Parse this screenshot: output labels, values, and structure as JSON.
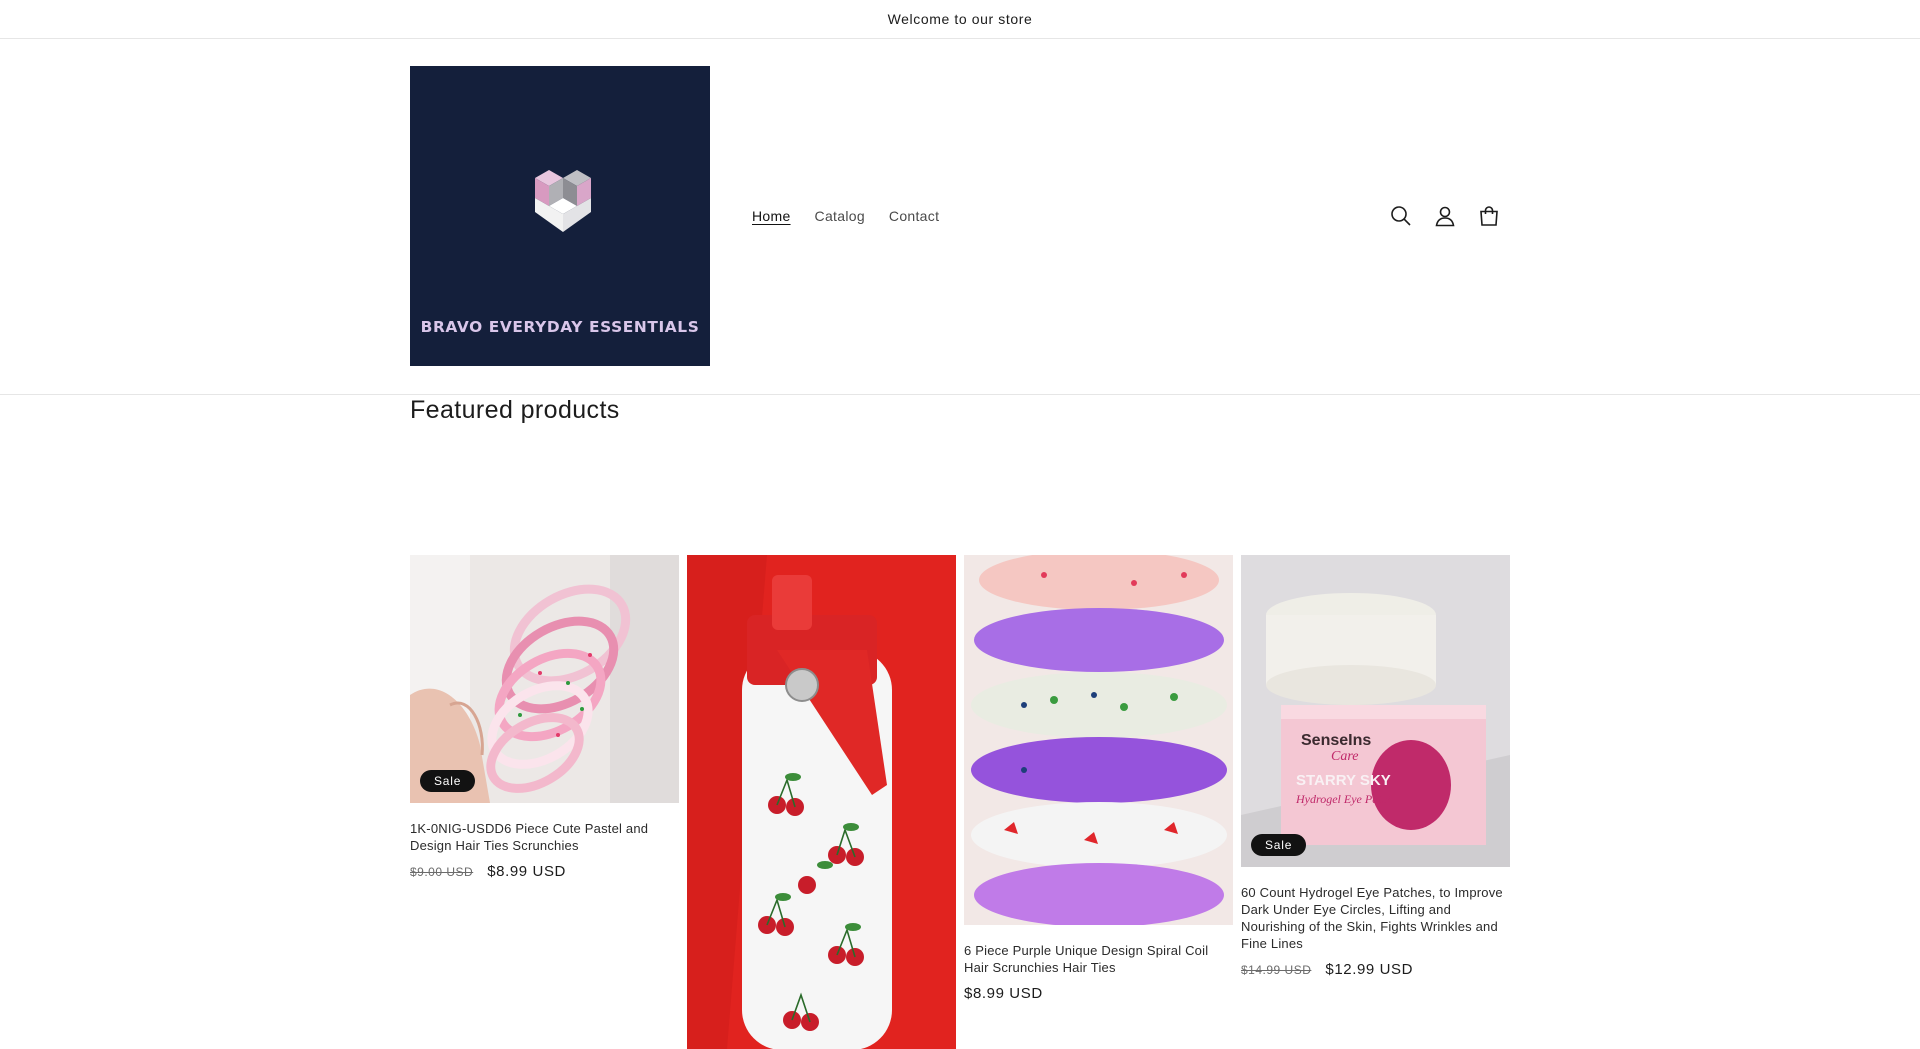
{
  "announcement": {
    "text": "Welcome to our store"
  },
  "brand": {
    "name": "BRAVO EVERYDAY ESSENTIALS",
    "bg": "#141f3b"
  },
  "nav": {
    "items": [
      {
        "label": "Home",
        "active": true
      },
      {
        "label": "Catalog",
        "active": false
      },
      {
        "label": "Contact",
        "active": false
      }
    ]
  },
  "header_icons": [
    "search-icon",
    "account-icon",
    "cart-icon"
  ],
  "featured": {
    "heading": "Featured products",
    "products": [
      {
        "title": "1K-0NIG-USDD6 Piece Cute Pastel and Design Hair Ties Scrunchies",
        "compare_price": "$9.00 USD",
        "price": "$8.99 USD",
        "badge": "Sale"
      },
      {
        "title": "",
        "compare_price": "",
        "price": "",
        "badge": ""
      },
      {
        "title": "6 Piece Purple Unique Design Spiral Coil Hair Scrunchies Hair Ties",
        "compare_price": "",
        "price": "$8.99 USD",
        "badge": ""
      },
      {
        "title": "60 Count Hydrogel Eye Patches, to Improve Dark Under Eye Circles, Lifting and Nourishing of the Skin, Fights Wrinkles and Fine Lines",
        "compare_price": "$14.99 USD",
        "price": "$12.99 USD",
        "badge": "Sale"
      }
    ],
    "packaging_text": {
      "brand": "SenseIns",
      "sub": "Care",
      "line1": "STARRY SKY",
      "line2": "Hydrogel Eye Patch"
    }
  }
}
